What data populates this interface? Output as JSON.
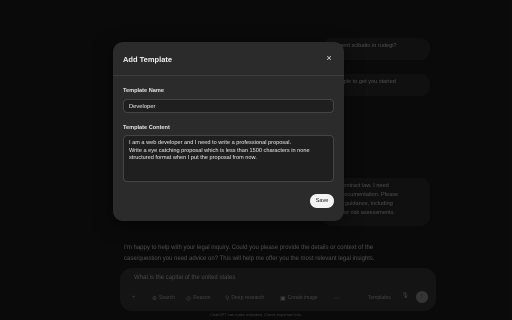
{
  "background": {
    "user_bubble_1": [
      "plement scibatio in rudegi?"
    ],
    "user_bubble_2": [
      "example to get you started"
    ],
    "user_bubble_3": [
      "g in contract law. I need",
      "e or documentation. Please",
      "ovide guidance, including",
      "ures, or risk assessments."
    ],
    "assistant_message": [
      "I'm happy to help with your legal inquiry. Could you please provide the details or context of the",
      "case/question you need advice on? This will help me offer you the most relevant legal insights."
    ],
    "composer": {
      "input_text": "What is the capital of the united states",
      "tools": [
        {
          "icon": "+",
          "label": ""
        },
        {
          "icon": "⊕",
          "label": "Search"
        },
        {
          "icon": "◎",
          "label": "Reason"
        },
        {
          "icon": "⚲",
          "label": "Deep research"
        },
        {
          "icon": "▣",
          "label": "Create image"
        },
        {
          "icon": "⋯",
          "label": ""
        }
      ],
      "templates_label": "Templates"
    },
    "footer": "ChatGPT can make mistakes. Check important info."
  },
  "modal": {
    "title": "Add Template",
    "close_glyph": "×",
    "name_label": "Template Name",
    "name_value": "Developer",
    "content_label": "Template Content",
    "content_lines": [
      "I am a web developer and I need to write a professional proposal.",
      "Write a eye catching proposal which is less than 1500 characters in none",
      "structured format when I put the proposal from now."
    ],
    "save_label": "Save"
  },
  "colors": {
    "page_bg": "#0f0f0f",
    "modal_bg": "#2b2b2b",
    "input_bg": "#1f1f1f",
    "save_button_bg": "#f4f4f4"
  }
}
